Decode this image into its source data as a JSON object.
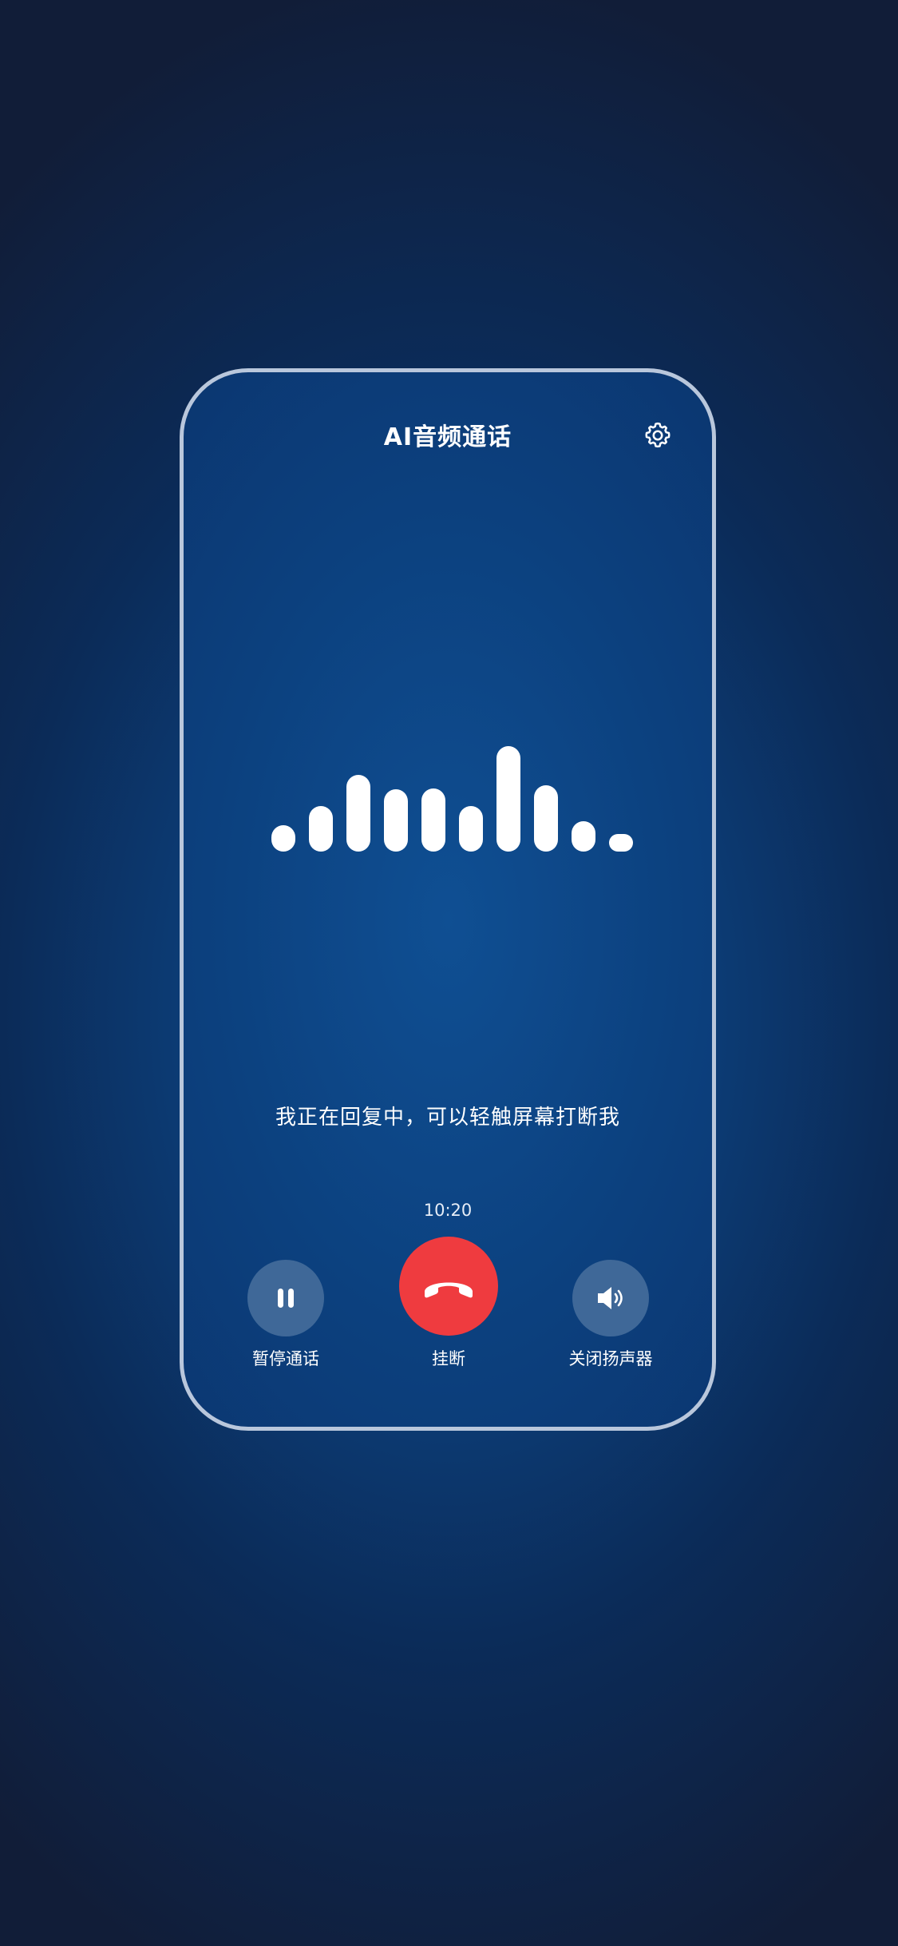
{
  "header": {
    "title": "AI音频通话",
    "settings_icon": "gear-icon"
  },
  "waveform": {
    "icon": "audio-waveform",
    "levels": [
      0.25,
      0.43,
      0.73,
      0.59,
      0.6,
      0.43,
      1.0,
      0.63,
      0.29,
      0.08
    ]
  },
  "status": {
    "message": "我正在回复中，可以轻触屏幕打断我",
    "timer": "10:20"
  },
  "controls": {
    "pause": {
      "label": "暂停通话",
      "icon": "pause-icon"
    },
    "hangup": {
      "label": "挂断",
      "icon": "hang-up-phone-icon",
      "color": "#ef3b3f"
    },
    "speaker": {
      "label": "关闭扬声器",
      "icon": "speaker-icon"
    }
  },
  "colors": {
    "background": "#0c3d77",
    "frame_border": "#b9c7dc",
    "control_button": "#3f6898",
    "hangup": "#ef3b3f"
  }
}
